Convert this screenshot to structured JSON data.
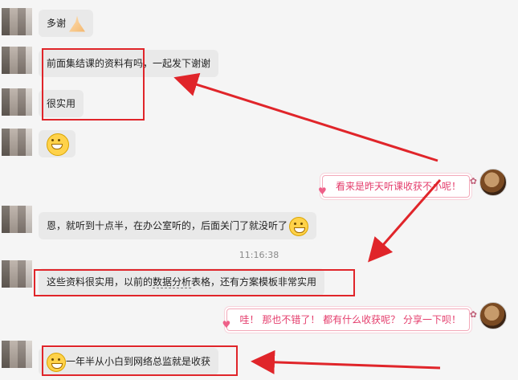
{
  "messages": {
    "m1": "多谢",
    "m2": "前面集结课的资料有吗，一起发下谢谢",
    "m3": "很实用",
    "m5": "恩，就听到十点半，在办公室听的，后面关门了就没听了",
    "m6_a": "这些资料很实用，以前的",
    "m6_b": "数据分析",
    "m6_c": "表格，还有方案模板非常实用",
    "m7": "一年半从小白到网络总监就是收获"
  },
  "replies": {
    "r1": "看来是昨天听课收获不小呢！",
    "r2": "哇！ 那也不错了！ 都有什么收获呢？ 分享一下呗！"
  },
  "timestamp": "11:16:38",
  "colors": {
    "highlight": "#e0252a",
    "reply_text": "#e43d6c",
    "bubble": "#e9e9e9",
    "background": "#f5f5f5"
  },
  "icons": {
    "grin": "grinning-face-icon",
    "hands": "praying-hands-icon",
    "pleading": "pleading-face-icon",
    "heart": "heart-icon",
    "bow": "bow-icon"
  }
}
